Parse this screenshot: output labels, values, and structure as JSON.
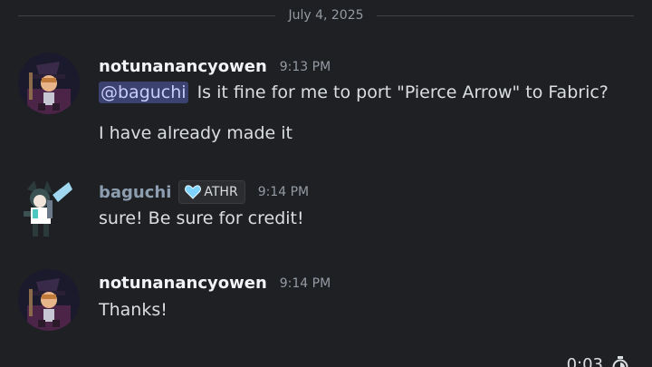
{
  "divider": {
    "date": "July 4, 2025"
  },
  "messages": [
    {
      "username": "notunanancyowen",
      "timestamp": "9:13 PM",
      "mention": "@baguchi",
      "lines": [
        "Is it fine for me to port \"Pierce Arrow\" to Fabric?",
        "I have already made it"
      ]
    },
    {
      "username": "baguchi",
      "tag": "ATHR",
      "timestamp": "9:14 PM",
      "lines": [
        "sure! Be sure for credit!"
      ]
    },
    {
      "username": "notunanancyowen",
      "timestamp": "9:14 PM",
      "lines": [
        "Thanks!"
      ]
    }
  ],
  "timer": {
    "value": "0:03",
    "icon": "stopwatch-icon"
  },
  "colors": {
    "background": "#1f2023",
    "mention_bg": "#3c4270",
    "mention_text": "#c9cdfb",
    "username_alt": "#8c9eb0",
    "tag_heart": "#7fd3ff"
  }
}
